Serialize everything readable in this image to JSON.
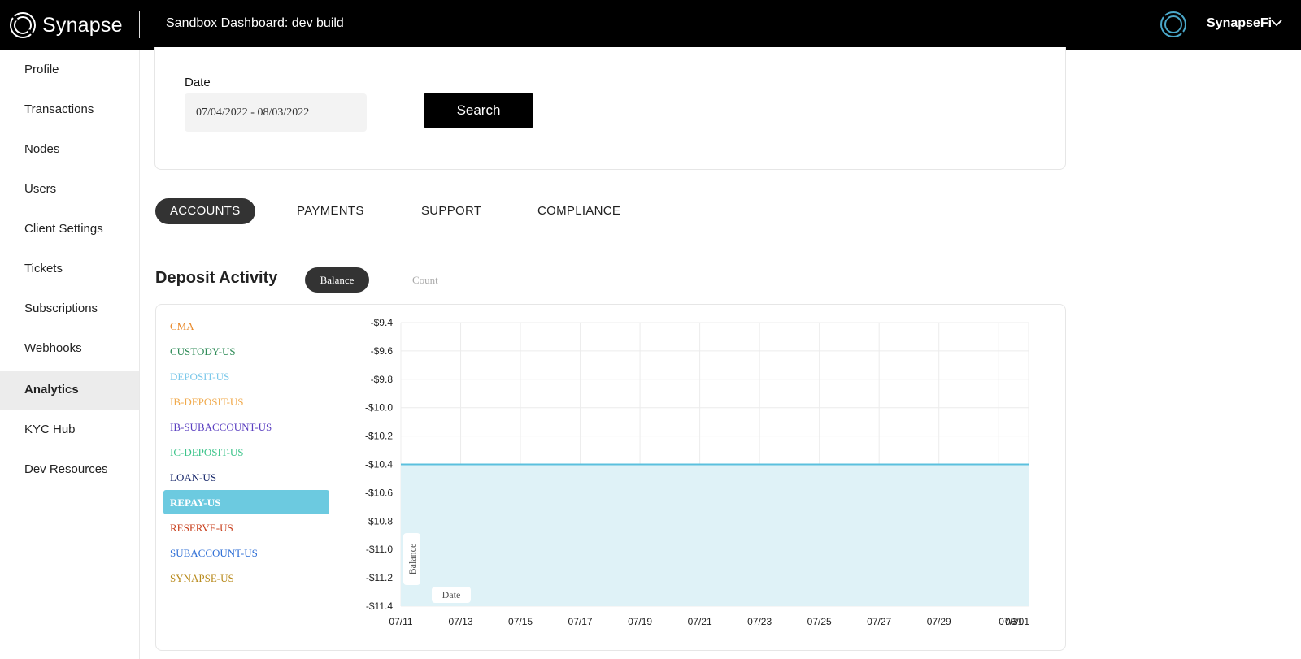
{
  "header": {
    "brand": "Synapse",
    "environment_title": "Sandbox Dashboard: dev build",
    "user_name": "SynapseFi"
  },
  "sidebar": {
    "items": [
      {
        "label": "Profile"
      },
      {
        "label": "Transactions"
      },
      {
        "label": "Nodes"
      },
      {
        "label": "Users"
      },
      {
        "label": "Client Settings"
      },
      {
        "label": "Tickets"
      },
      {
        "label": "Subscriptions"
      },
      {
        "label": "Webhooks"
      },
      {
        "label": "Analytics",
        "active": true
      },
      {
        "label": "KYC Hub"
      },
      {
        "label": "Dev Resources"
      }
    ]
  },
  "search": {
    "date_label": "Date",
    "date_value": "07/04/2022 - 08/03/2022",
    "search_button": "Search"
  },
  "tabs": [
    {
      "label": "ACCOUNTS",
      "active": true
    },
    {
      "label": "PAYMENTS"
    },
    {
      "label": "SUPPORT"
    },
    {
      "label": "COMPLIANCE"
    }
  ],
  "deposit": {
    "title": "Deposit Activity",
    "toggle_balance": "Balance",
    "toggle_count": "Count",
    "legend": [
      {
        "label": "CMA",
        "color": "#e98a2c"
      },
      {
        "label": "CUSTODY-US",
        "color": "#2e8b57"
      },
      {
        "label": "DEPOSIT-US",
        "color": "#7cc8ea"
      },
      {
        "label": "IB-DEPOSIT-US",
        "color": "#f0a94a"
      },
      {
        "label": "IB-SUBACCOUNT-US",
        "color": "#5a3fc0"
      },
      {
        "label": "IC-DEPOSIT-US",
        "color": "#3cc48a"
      },
      {
        "label": "LOAN-US",
        "color": "#1a2a6c"
      },
      {
        "label": "REPAY-US",
        "color": "#ffffff",
        "active": true
      },
      {
        "label": "RESERVE-US",
        "color": "#c8401e"
      },
      {
        "label": "SUBACCOUNT-US",
        "color": "#2f6fd6"
      },
      {
        "label": "SYNAPSE-US",
        "color": "#b88a1c"
      }
    ]
  },
  "chart_data": {
    "type": "area",
    "x_categories": [
      "07/11",
      "07/13",
      "07/15",
      "07/17",
      "07/19",
      "07/21",
      "07/23",
      "07/25",
      "07/27",
      "07/29",
      "07/31",
      "08/01"
    ],
    "series": [
      {
        "name": "REPAY-US",
        "color": "#5bc0de",
        "fill": "#dff2f7",
        "x": [
          "07/11",
          "07/13",
          "07/15",
          "07/17",
          "07/19",
          "07/21",
          "07/23",
          "07/25",
          "07/27",
          "07/29",
          "07/31",
          "08/01"
        ],
        "values": [
          -10.4,
          -10.4,
          -10.4,
          -10.4,
          -10.4,
          -10.4,
          -10.4,
          -10.4,
          -10.4,
          -10.4,
          -10.4,
          -10.4
        ]
      }
    ],
    "y_ticks": [
      "-$9.4",
      "-$9.6",
      "-$9.8",
      "-$10.0",
      "-$10.2",
      "-$10.4",
      "-$10.6",
      "-$10.8",
      "-$11.0",
      "-$11.2",
      "-$11.4"
    ],
    "ylim": [
      -11.4,
      -9.4
    ],
    "xlabel": "Date",
    "ylabel": "Balance",
    "grid": true,
    "legend": "left"
  }
}
